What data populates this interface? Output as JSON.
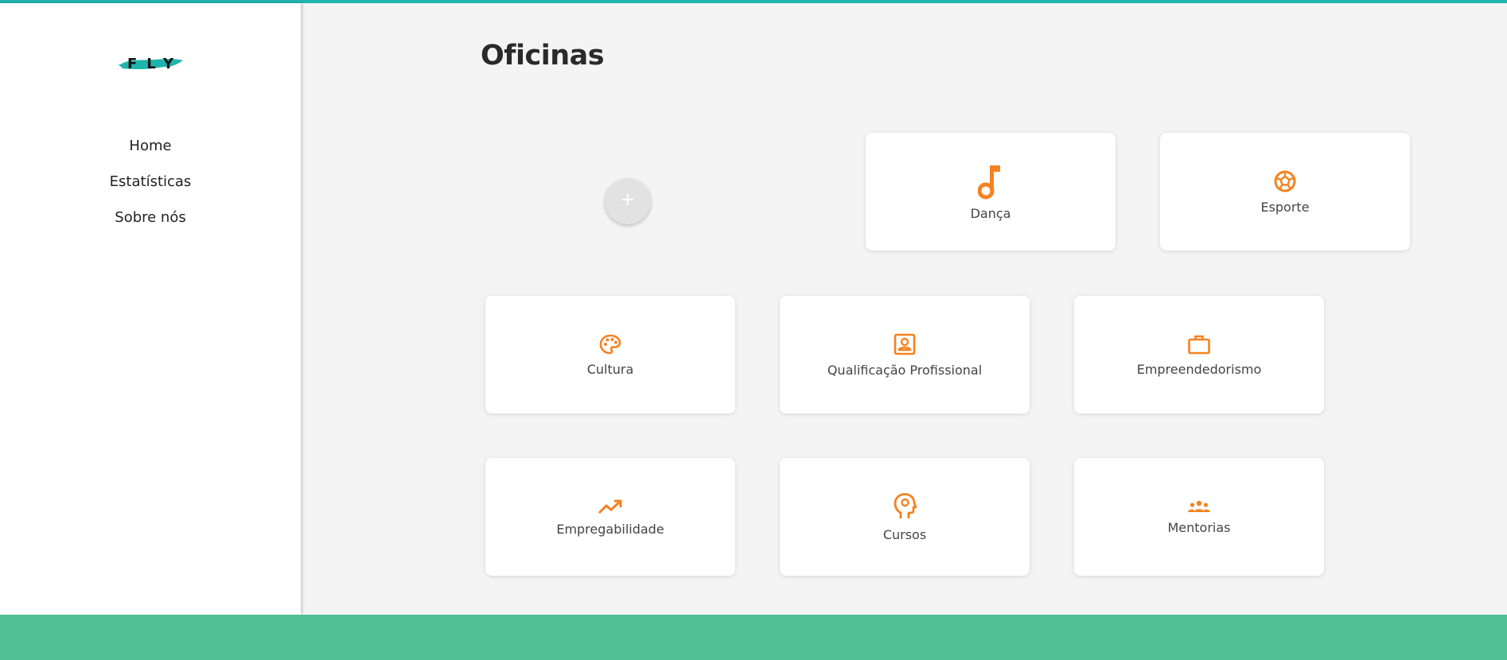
{
  "app": {
    "logo_text": "FLY",
    "accent_color": "#f58220",
    "brand_color": "#1fb5ad",
    "footer_color": "#4fc192"
  },
  "sidebar": {
    "items": [
      {
        "label": "Home"
      },
      {
        "label": "Estatísticas"
      },
      {
        "label": "Sobre nós"
      }
    ]
  },
  "main": {
    "title": "Oficinas",
    "add_button_label": "+",
    "cards": [
      {
        "label": "Dança",
        "icon": "music-note-icon"
      },
      {
        "label": "Esporte",
        "icon": "soccer-ball-icon"
      },
      {
        "label": "Cultura",
        "icon": "palette-icon"
      },
      {
        "label": "Qualificação Profissional",
        "icon": "contact-card-icon"
      },
      {
        "label": "Empreendedorismo",
        "icon": "briefcase-icon"
      },
      {
        "label": "Empregabilidade",
        "icon": "trending-up-icon"
      },
      {
        "label": "Cursos",
        "icon": "head-idea-icon"
      },
      {
        "label": "Mentorias",
        "icon": "group-icon"
      }
    ]
  }
}
